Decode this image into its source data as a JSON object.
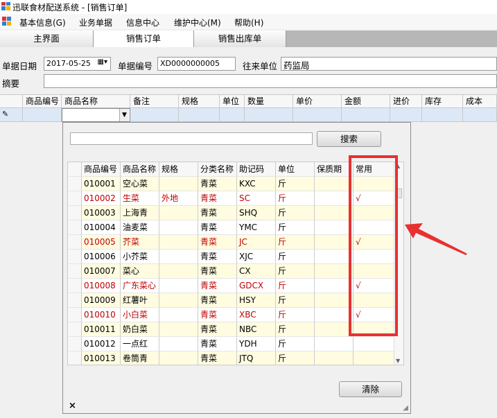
{
  "window": {
    "title": "迅联食材配送系统 - [销售订单]"
  },
  "menu": [
    "基本信息(G)",
    "业务单据",
    "信息中心",
    "维护中心(M)",
    "帮助(H)"
  ],
  "tabs": [
    "主界面",
    "销售订单",
    "销售出库单"
  ],
  "form": {
    "date_label": "单据日期",
    "date_value": "2017-05-25",
    "number_label": "单据编号",
    "number_value": "XD0000000005",
    "partner_label": "往来单位",
    "partner_value": "药监局",
    "memo_label": "摘要"
  },
  "grid": {
    "headers": [
      "商品编号",
      "商品名称",
      "备注",
      "规格",
      "单位",
      "数量",
      "单价",
      "金额",
      "进价",
      "库存",
      "成本"
    ]
  },
  "popup": {
    "search_button": "搜索",
    "clear_button": "清除",
    "close_symbol": "×",
    "headers": [
      "商品编号",
      "商品名称",
      "规格",
      "分类名称",
      "助记码",
      "单位",
      "保质期",
      "常用"
    ],
    "rows": [
      {
        "code": "010001",
        "name": "空心菜",
        "spec": "",
        "category": "青菜",
        "mnemonic": "KXC",
        "unit": "斤",
        "common": "",
        "red": false
      },
      {
        "code": "010002",
        "name": "生菜",
        "spec": "外地",
        "category": "青菜",
        "mnemonic": "SC",
        "unit": "斤",
        "common": "√",
        "red": true
      },
      {
        "code": "010003",
        "name": "上海青",
        "spec": "",
        "category": "青菜",
        "mnemonic": "SHQ",
        "unit": "斤",
        "common": "",
        "red": false
      },
      {
        "code": "010004",
        "name": "油麦菜",
        "spec": "",
        "category": "青菜",
        "mnemonic": "YMC",
        "unit": "斤",
        "common": "",
        "red": false
      },
      {
        "code": "010005",
        "name": "芥菜",
        "spec": "",
        "category": "青菜",
        "mnemonic": "JC",
        "unit": "斤",
        "common": "√",
        "red": true
      },
      {
        "code": "010006",
        "name": "小芥菜",
        "spec": "",
        "category": "青菜",
        "mnemonic": "XJC",
        "unit": "斤",
        "common": "",
        "red": false
      },
      {
        "code": "010007",
        "name": "菜心",
        "spec": "",
        "category": "青菜",
        "mnemonic": "CX",
        "unit": "斤",
        "common": "",
        "red": false
      },
      {
        "code": "010008",
        "name": "广东菜心",
        "spec": "",
        "category": "青菜",
        "mnemonic": "GDCX",
        "unit": "斤",
        "common": "√",
        "red": true
      },
      {
        "code": "010009",
        "name": "红薯叶",
        "spec": "",
        "category": "青菜",
        "mnemonic": "HSY",
        "unit": "斤",
        "common": "",
        "red": false
      },
      {
        "code": "010010",
        "name": "小白菜",
        "spec": "",
        "category": "青菜",
        "mnemonic": "XBC",
        "unit": "斤",
        "common": "√",
        "red": true
      },
      {
        "code": "010011",
        "name": "奶白菜",
        "spec": "",
        "category": "青菜",
        "mnemonic": "NBC",
        "unit": "斤",
        "common": "",
        "red": false
      },
      {
        "code": "010012",
        "name": "一点红",
        "spec": "",
        "category": "青菜",
        "mnemonic": "YDH",
        "unit": "斤",
        "common": "",
        "red": false
      },
      {
        "code": "010013",
        "name": "卷筒青",
        "spec": "",
        "category": "青菜",
        "mnemonic": "JTQ",
        "unit": "斤",
        "common": "",
        "red": false
      }
    ]
  },
  "colors": {
    "annotation": "#e83030",
    "highlight_text": "#c00000"
  }
}
